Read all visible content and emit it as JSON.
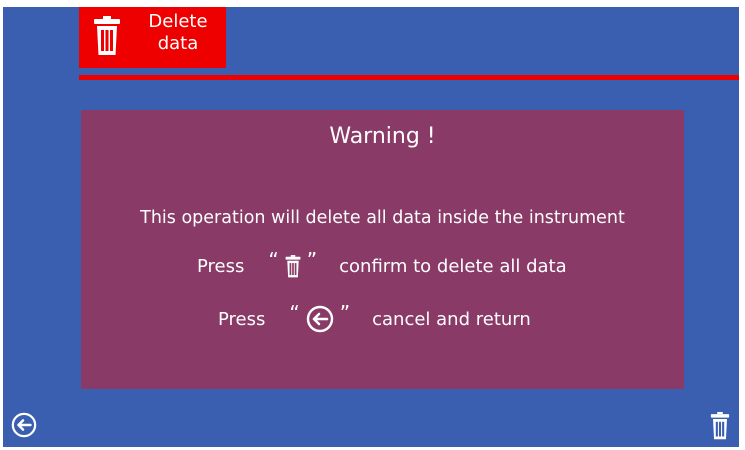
{
  "header": {
    "tab_label_line1": "Delete",
    "tab_label_line2": "data",
    "tab_icon": "trash-icon",
    "accent_color": "#ee0000"
  },
  "dialog": {
    "title": "Warning !",
    "message": "This operation will delete all data inside the instrument",
    "confirm_row": {
      "press": "Press",
      "open_quote": "“",
      "icon": "trash-icon",
      "close_quote": "”",
      "action": "confirm to delete all data"
    },
    "cancel_row": {
      "press": "Press",
      "open_quote": "“",
      "icon": "back-arrow-icon",
      "close_quote": "”",
      "action": "cancel and return"
    },
    "background_color": "#893a67"
  },
  "footer": {
    "back_icon": "back-arrow-icon",
    "delete_icon": "trash-icon"
  },
  "screen_background": "#3a5fb0"
}
